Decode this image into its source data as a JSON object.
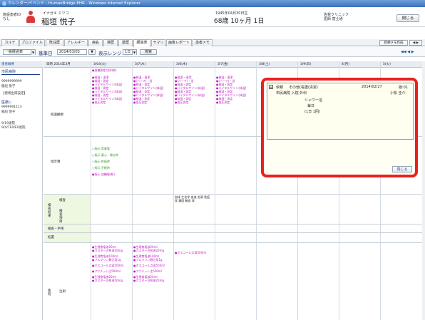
{
  "window_title": "カレンダー/イベント - HumanBridge EHR - Windows Internet Explorer",
  "patient": {
    "label_line1": "施設患者ID",
    "label_line2": "なし",
    "kana": "イナガキ エツコ",
    "name": "稲垣 悦子",
    "dob": "1945年04月30日生",
    "age": "68歳 10ヶ月 1日",
    "hospital_line1": "佐賀クリニック",
    "hospital_line2": "医師 富士通",
    "close": "閉じる"
  },
  "tabs": [
    "カルテ",
    "プロファイル",
    "既往歴",
    "アレルギー",
    "病名",
    "検歴",
    "薬歴",
    "経過表",
    "サマリ",
    "画像レポート",
    "患者メモ"
  ],
  "active_tab": "経過表",
  "tabs_right": {
    "new": "新規メモ作成",
    "arrow": "◀ ▶"
  },
  "toolbar": {
    "view_select": "一般経過表",
    "base_label": "基準日",
    "base_date": "2014/03/03",
    "range_label": "表示レンジ",
    "range_value": "1日",
    "search": "検索",
    "nav": "◀◀ ◀ ▶"
  },
  "sidebar": {
    "header": "患者概要",
    "hospital": "市民病院",
    "items": [
      "9999999999",
      "稲垣 悦子",
      "【患者出席設定】",
      "医療◇",
      "9999991113",
      "稲垣 悦子",
      "9/19退院",
      "9/4/7E0/E0退院"
    ]
  },
  "columns": [
    "日時 2014年3月",
    "3/04(火)",
    "3/7(水)",
    "3/6(木)",
    "3/7(金)",
    "3/8(土)",
    "3/9(日)",
    "4(月)",
    "5(火)"
  ],
  "rows": {
    "row1": "経過観察",
    "row2": "指示簿",
    "row3": "検査結果",
    "row3a": "検査",
    "row3b": "検査項目",
    "row4": "検査・手術",
    "row5": "処置",
    "row6": "薬剤",
    "row6a": "注射"
  },
  "cells": {
    "c1": [
      "●血糖測定(合料剤)"
    ],
    "obs": [
      "●検温・清潔",
      "●(ハーフ)・浴",
      "●検温・測定",
      "●バイタルサイン(体温)",
      "●検温・測定",
      "●バイタルサイン(体温)",
      "●検温・測定",
      "●バイタルサイン(体温)",
      "●検温・測定",
      "●血圧測定"
    ],
    "orders": [
      "○指示:食事箋",
      "○指示:悪心・嘔吐時",
      "○指示:疼痛時",
      "○指示:不眠時",
      "●指示:血糖値(新)"
    ],
    "lab": [
      "血球 生化学 血液 血清 免疫 尿 凝固 輸血 尿"
    ],
    "inj": [
      "●生理食塩液20ml",
      "●ガスター注射液20mg",
      "●生理食塩液100ml",
      "●ブルマリン静注用1g",
      "●ボスコール点滴500ml",
      "●アクチット注500ml",
      "●生理食塩液20ml",
      "●ガスター注射液20mg"
    ],
    "inj2": [
      "●生理食塩液20ml",
      "●ガスター注射液20mg",
      "●生理食塩液100ml",
      "●ブルマリン静注用1g",
      "●ボスコール点滴500ml",
      "●アクチット注500ml",
      "●生理食塩液20ml",
      "●ガスター注射液20mg"
    ],
    "inj3": [
      "●ボスコール点滴500ml"
    ]
  },
  "popup": {
    "kind": "依頼",
    "title": "その他(看護(清潔)",
    "date": "2014/02/27",
    "num": "版:01",
    "dept": "市民病院 入院 外科",
    "doctor": "小松 圭介",
    "item": "シャワー浴",
    "freq": "毎日",
    "times": "(1日 1回)",
    "close": "閉じる"
  },
  "colors": {
    "accent": "#1a2a6c",
    "tab_active": "#ffffff",
    "magenta": "#c020c0",
    "green": "#3a9a30",
    "highlight": "#e82020"
  }
}
